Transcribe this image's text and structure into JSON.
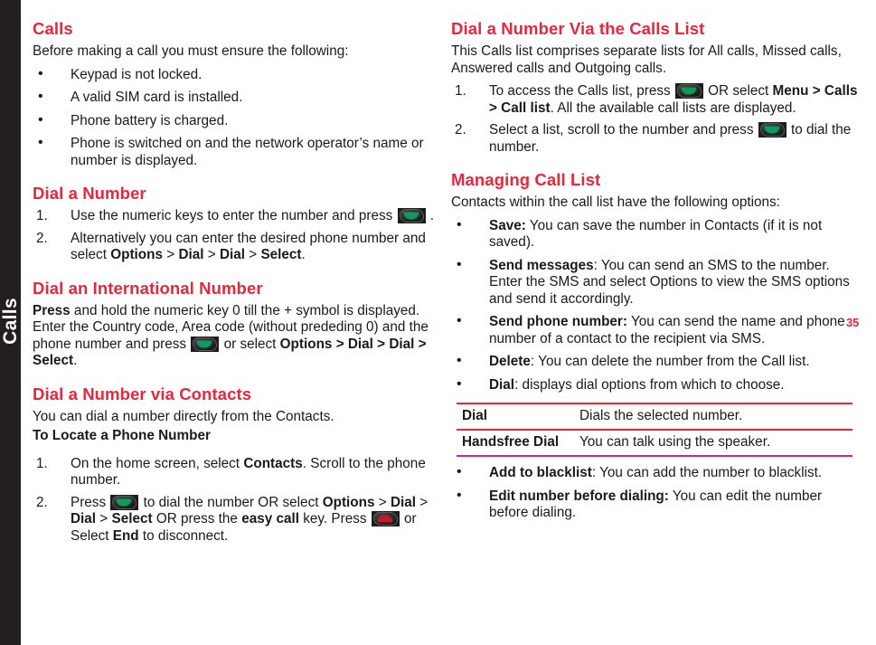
{
  "side_tab": {
    "label": "Calls"
  },
  "page_number": "35",
  "colors": {
    "heading_red": "#e8263c",
    "tab_black": "#231f20",
    "table_rule_red": "#e8263c",
    "table_rule_magenta": "#d6219e",
    "call_key_green": "#0f9b5e",
    "end_key_red": "#c1192b"
  },
  "left_column": {
    "heading_calls": "Calls",
    "intro": "Before making a call you must ensure the following:",
    "requirements": [
      "Keypad is not locked.",
      "A valid SIM card is installed.",
      "Phone battery is charged.",
      "Phone is switched on and the network operator’s name or number is displayed."
    ],
    "heading_dial_a_number": "Dial a Number",
    "dial_step1_pre": "Use the numeric keys to enter the number and press",
    "dial_step1_post": ".",
    "dial_step2_pre": "Alternatively you can enter the desired phone number and select ",
    "dial_step2_b1": "Options",
    "dial_step2_sep1": " > ",
    "dial_step2_b2": "Dial",
    "dial_step2_sep2": " > ",
    "dial_step2_b3": "Dial",
    "dial_step2_sep3": " > ",
    "dial_step2_b4": "Select",
    "dial_step2_post": ".",
    "heading_international": "Dial an International Number",
    "intl_b1": "Press",
    "intl_t1": " and hold the numeric key 0 till the + symbol is displayed. Enter the Country code, Area code (without prededing 0) and the phone number and press ",
    "intl_t2": " or select ",
    "intl_b2": "Options > Dial > Dial > Select",
    "intl_t3": ".",
    "heading_via_contacts": "Dial a Number via Contacts",
    "via_contacts_intro": "You can dial a number directly from the Contacts.",
    "subhead_locate": "To Locate a Phone Number",
    "locate_step1_pre": "On the home screen, select ",
    "locate_step1_b1": "Contacts",
    "locate_step1_post": ". Scroll to the phone number.",
    "locate_step2_p1": "Press ",
    "locate_step2_p2": " to dial the number OR select ",
    "locate_step2_b1": "Options",
    "locate_step2_p3": " > ",
    "locate_step2_b2": "Dial",
    "locate_step2_p4": " > ",
    "locate_step2_b3": "Dial",
    "locate_step2_p5": " > ",
    "locate_step2_b4": "Select",
    "locate_step2_p6": " OR press the ",
    "locate_step2_b5": "easy call",
    "locate_step2_p7": " key. Press ",
    "locate_step2_p8": " or Select ",
    "locate_step2_b6": "End",
    "locate_step2_p9": " to disconnect."
  },
  "right_column": {
    "heading_via_calls_list": "Dial a Number Via the Calls List",
    "calls_list_intro": "This Calls list comprises separate lists for All calls, Missed calls, Answered calls and Outgoing calls.",
    "cl_step1_p1": "To access the Calls list, press ",
    "cl_step1_p2": " OR select ",
    "cl_step1_b1": "Menu > Calls > Call list",
    "cl_step1_p3": ". All the available call lists are displayed.",
    "cl_step2_p1": "Select a list, scroll to the number and press ",
    "cl_step2_p2": " to dial the number.",
    "heading_managing": "Managing Call List",
    "managing_intro": "Contacts within the call list have the following options:",
    "options": [
      {
        "term": "Save:",
        "desc": " You can save the number in Contacts (if it is not saved)."
      },
      {
        "term": "Send messages",
        "desc": ": You can send an SMS to the number. Enter the SMS and select Options to view the SMS options and send it accordingly."
      },
      {
        "term": "Send phone number:",
        "desc": " You can send the name and phone number of a contact to the recipient via SMS."
      },
      {
        "term": "Delete",
        "desc": ": You can delete the number from the Call list."
      },
      {
        "term": "Dial",
        "desc": ": displays dial options from which to choose."
      }
    ],
    "table": {
      "rows": [
        {
          "key": "Dial",
          "value": "Dials the selected number."
        },
        {
          "key": "Handsfree Dial",
          "value": "You can talk using the speaker."
        }
      ]
    },
    "options_after_table": [
      {
        "term": "Add to blacklist",
        "desc": ": You can add the number to blacklist."
      },
      {
        "term": "Edit number before dialing:",
        "desc": " You can edit the number before dialing."
      }
    ]
  }
}
